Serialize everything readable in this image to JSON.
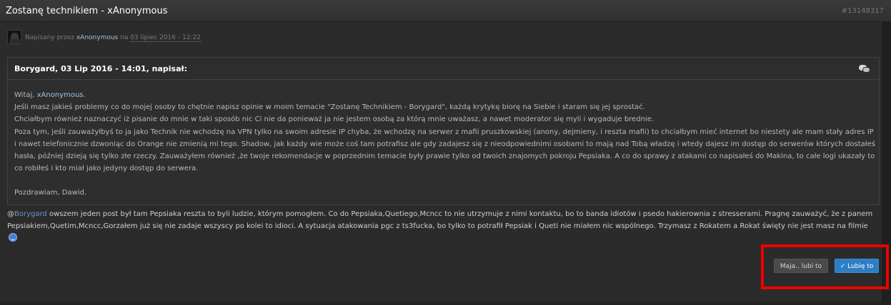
{
  "topbar": {
    "title": "Zostanę technikiem - xAnonymous",
    "post_id": "#13148317"
  },
  "meta": {
    "prefix": "Napisany przez",
    "author": "xAnonymous",
    "on": "na",
    "date": "03 lipiec 2016 - 12:22"
  },
  "quote": {
    "citation": "Borygard, 03 Lip 2016 - 14:01, napisał:",
    "greeting": "Witaj,",
    "greeting_mention": "xAnonymous",
    "greeting_end": ".",
    "p1": "Jeśli masz jakieś problemy co do mojej osoby to chętnie napisz opinie w moim temacie \"Zostanę Technikiem - Borygard\", każdą krytykę biorę na Siebie i staram się jej sprostać.",
    "p2": "Chciałbym również naznaczyć iż pisanie do mnie w taki sposób nic Ci nie da ponieważ ja nie jestem osobą za którą mnie uważasz, a nawet moderator się myli i wygaduje brednie.",
    "p3": "Poza tym, jeśli zauważyłbyś to ja jako Technik nie wchodzę na VPN tylko na swoim adresie IP chyba, że wchodzę na serwer z mafii pruszkowskiej (anony, dejmieny, i reszta mafii) to chciałbym mieć internet bo niestety ale mam stały adres IP i nawet telefonicznie dzwoniąc do Orange nie zmienią mi tego. Shadow, jak każdy wie może coś tam potrafisz ale gdy zadajesz się z nieodpowiednimi osobami to mają nad Tobą władzę i wtedy dajesz im dostęp do serwerów których dostałeś hasła, później dzieją się tylko złe rzeczy. Zauważyłem również ,że twoje rekomendacje w poprzednim temacie były prawie tylko od twoich znajomych pokroju Pepsiaka. A co do sprawy z atakami co napisałeś do Makina, to całe logi ukazały to co robiłeś i kto miał jako jedyny dostęp do serwera.",
    "signoff": "Pozdrawiam, Dawid."
  },
  "reply": {
    "at": "@",
    "mention": "Borygard",
    "text": " owszem jeden post był tam Pepsiaka reszta to byli ludzie, którym pomogłem. Co do Pepsiaka,Quetiego,Mcncc to nie utrzymuje z nimi kontaktu, bo to banda idiotów i psedo hakierownia z stresserami. Pragnę zauważyć, że z panem Pepsiakiem,Quetim,Mcncc,Gorzałem już się nie zadaje wszyscy po kolei to idioci. A sytuacja atakowania pgc z ts3fucka, bo tylko to potrafił Pepsiak i Queti nie miałem nic wspólnego. Trzymasz z Rokatem a Rokat święty nie jest masz na filmie"
  },
  "actions": {
    "maja_label": "Maja.. lubi to",
    "like_label": "✓ Lubię to"
  },
  "colors": {
    "background": "#2b2b2b",
    "accent": "#2d7fc4",
    "mention": "#9fc3e0",
    "highlight": "#ee0000"
  }
}
